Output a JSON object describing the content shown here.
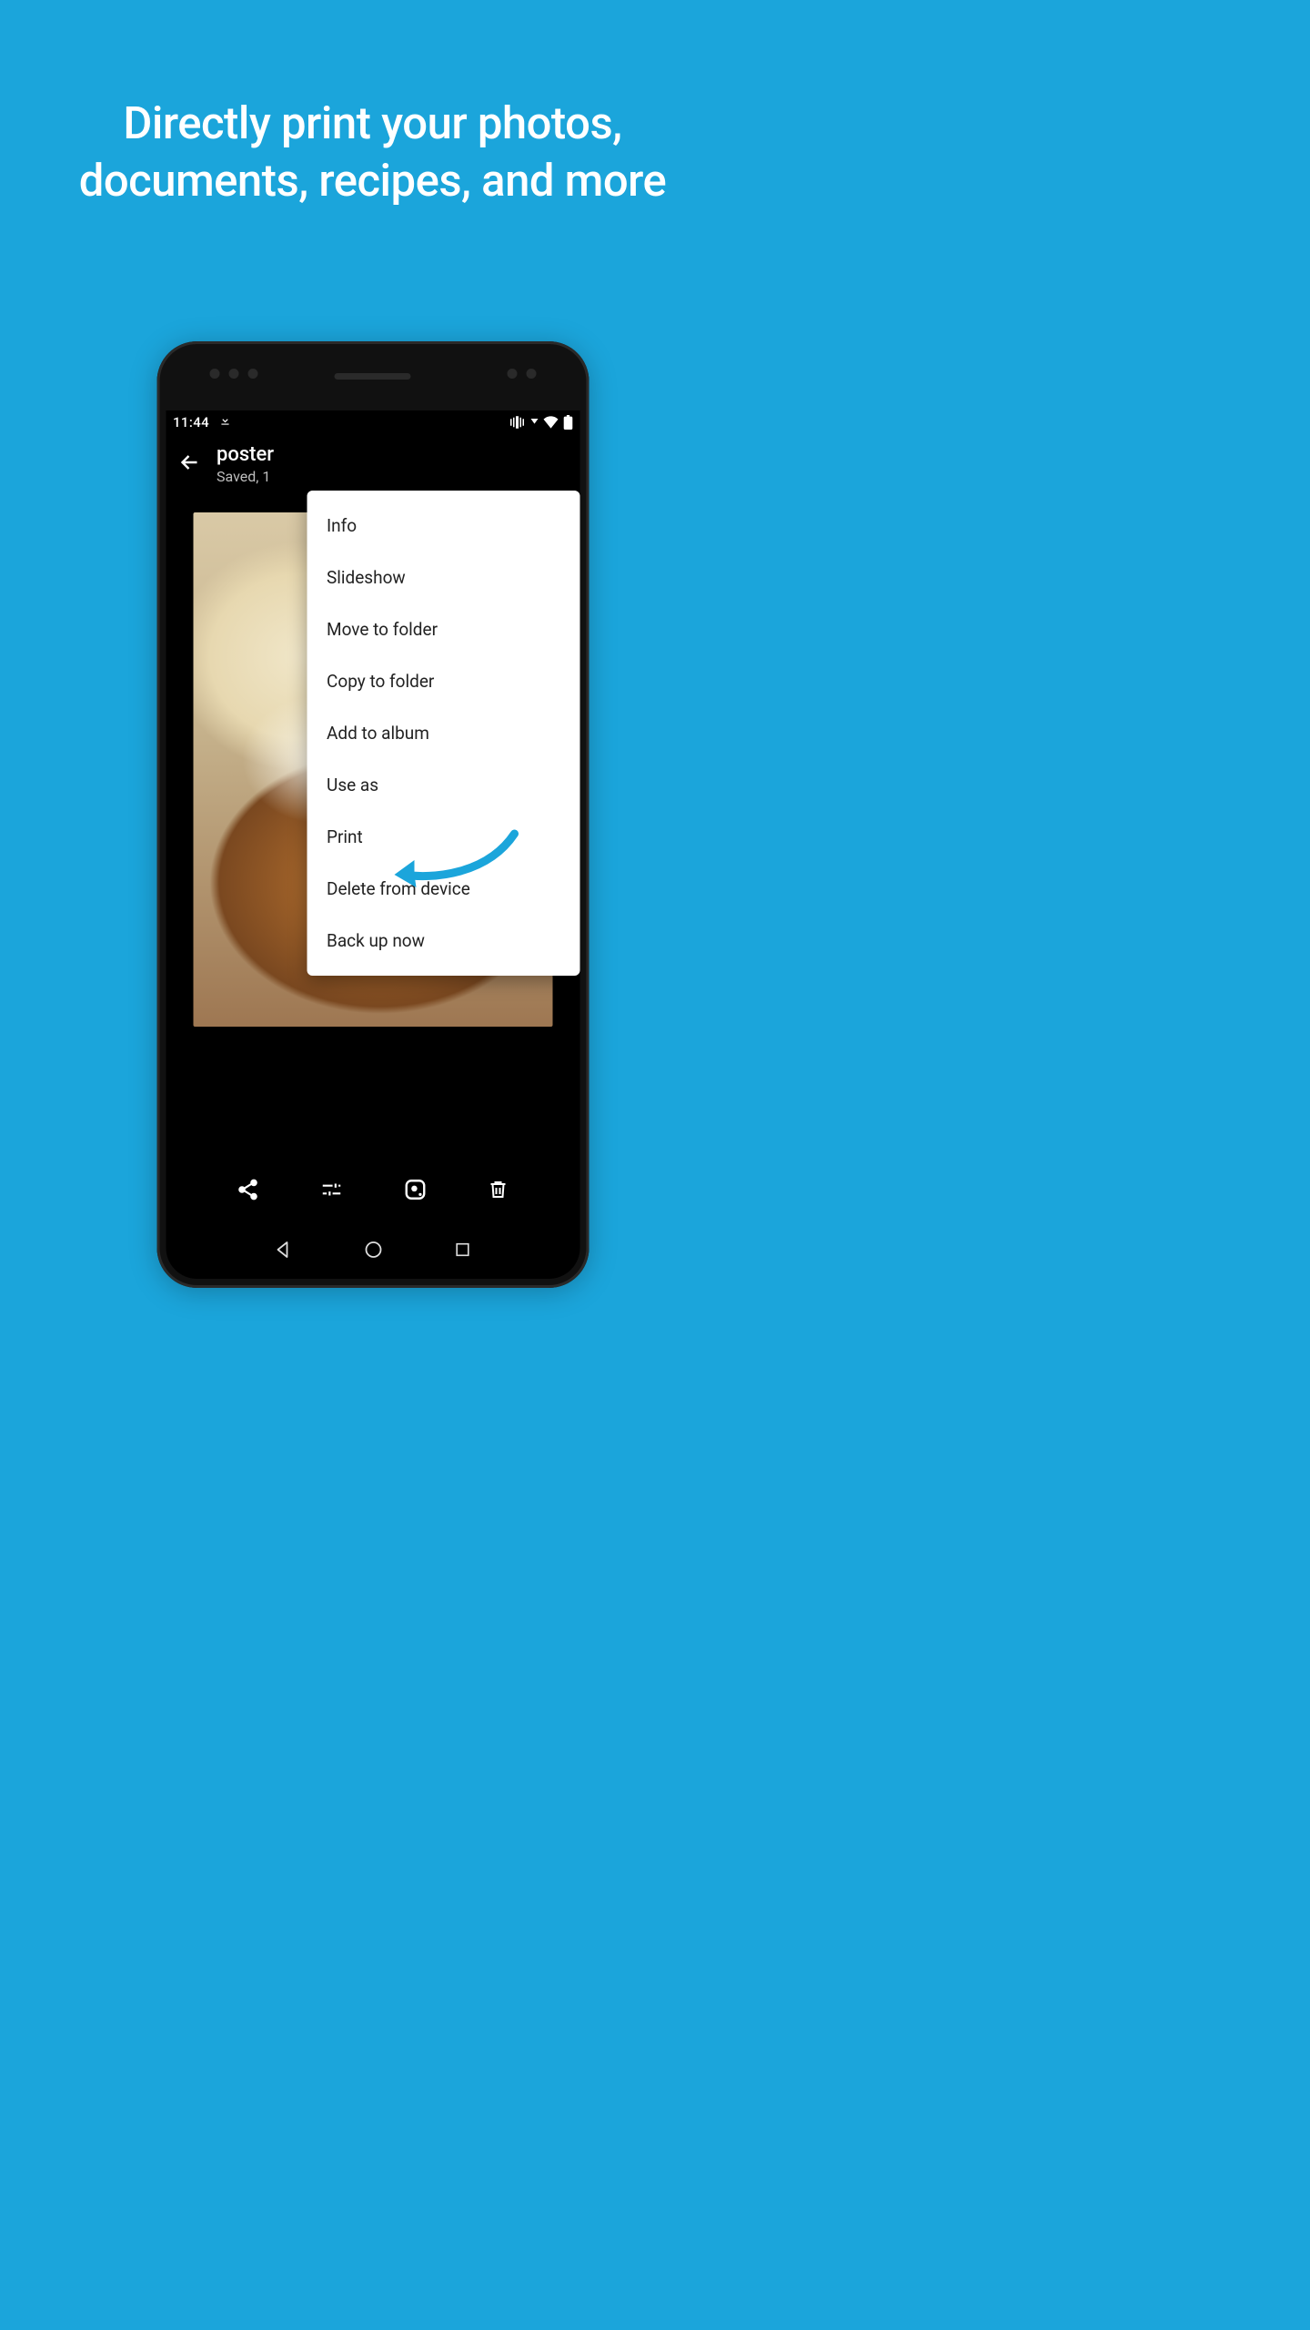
{
  "headline": "Directly print your photos, documents, recipes, and more",
  "statusbar": {
    "time": "11:44"
  },
  "appbar": {
    "title": "poster",
    "subtitle": "Saved, 1"
  },
  "menu": {
    "items": [
      "Info",
      "Slideshow",
      "Move to folder",
      "Copy to folder",
      "Add to album",
      "Use as",
      "Print",
      "Delete from device",
      "Back up now"
    ]
  }
}
